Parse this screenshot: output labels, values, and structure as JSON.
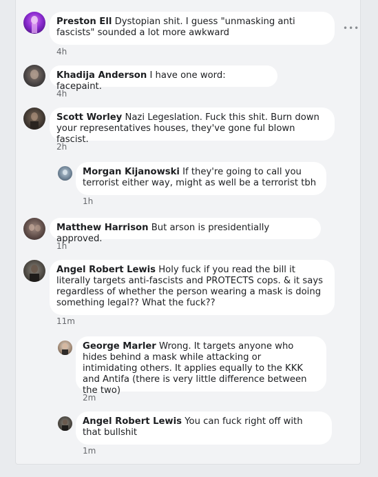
{
  "comments": [
    {
      "author": "Preston Ell",
      "text": "Dystopian shit. I guess \"unmasking anti fascists\" sounded a lot more awkward",
      "time": "4h"
    },
    {
      "author": "Khadija Anderson",
      "text": "I have one word: facepaint.",
      "time": "4h"
    },
    {
      "author": "Scott Worley",
      "text": "Nazi Legeslation. Fuck this shit. Burn down your representatives houses, they've gone ful blown fascist.",
      "time": "2h"
    },
    {
      "author": "Morgan Kijanowski",
      "text": "If they're going to call you terrorist either way, might as well be a terrorist tbh",
      "time": "1h"
    },
    {
      "author": "Matthew Harrison",
      "text": "But arson is presidentially approved.",
      "time": "1h"
    },
    {
      "author": "Angel Robert Lewis",
      "text": "Holy fuck if you read the bill it literally targets anti-fascists and PROTECTS cops. & it says regardless of whether the person wearing a mask is doing something legal?? What the fuck??",
      "time": "11m"
    },
    {
      "author": "George Marler",
      "text": "Wrong. It targets anyone who hides behind a mask while attacking or intimidating others. It applies equally to the KKK and Antifa (there is very little difference between the two)",
      "time": "2m"
    },
    {
      "author": "Angel Robert Lewis",
      "text": "You can fuck right off with that bullshit",
      "time": "1m"
    }
  ],
  "icons": {
    "more": "more-options-icon"
  }
}
